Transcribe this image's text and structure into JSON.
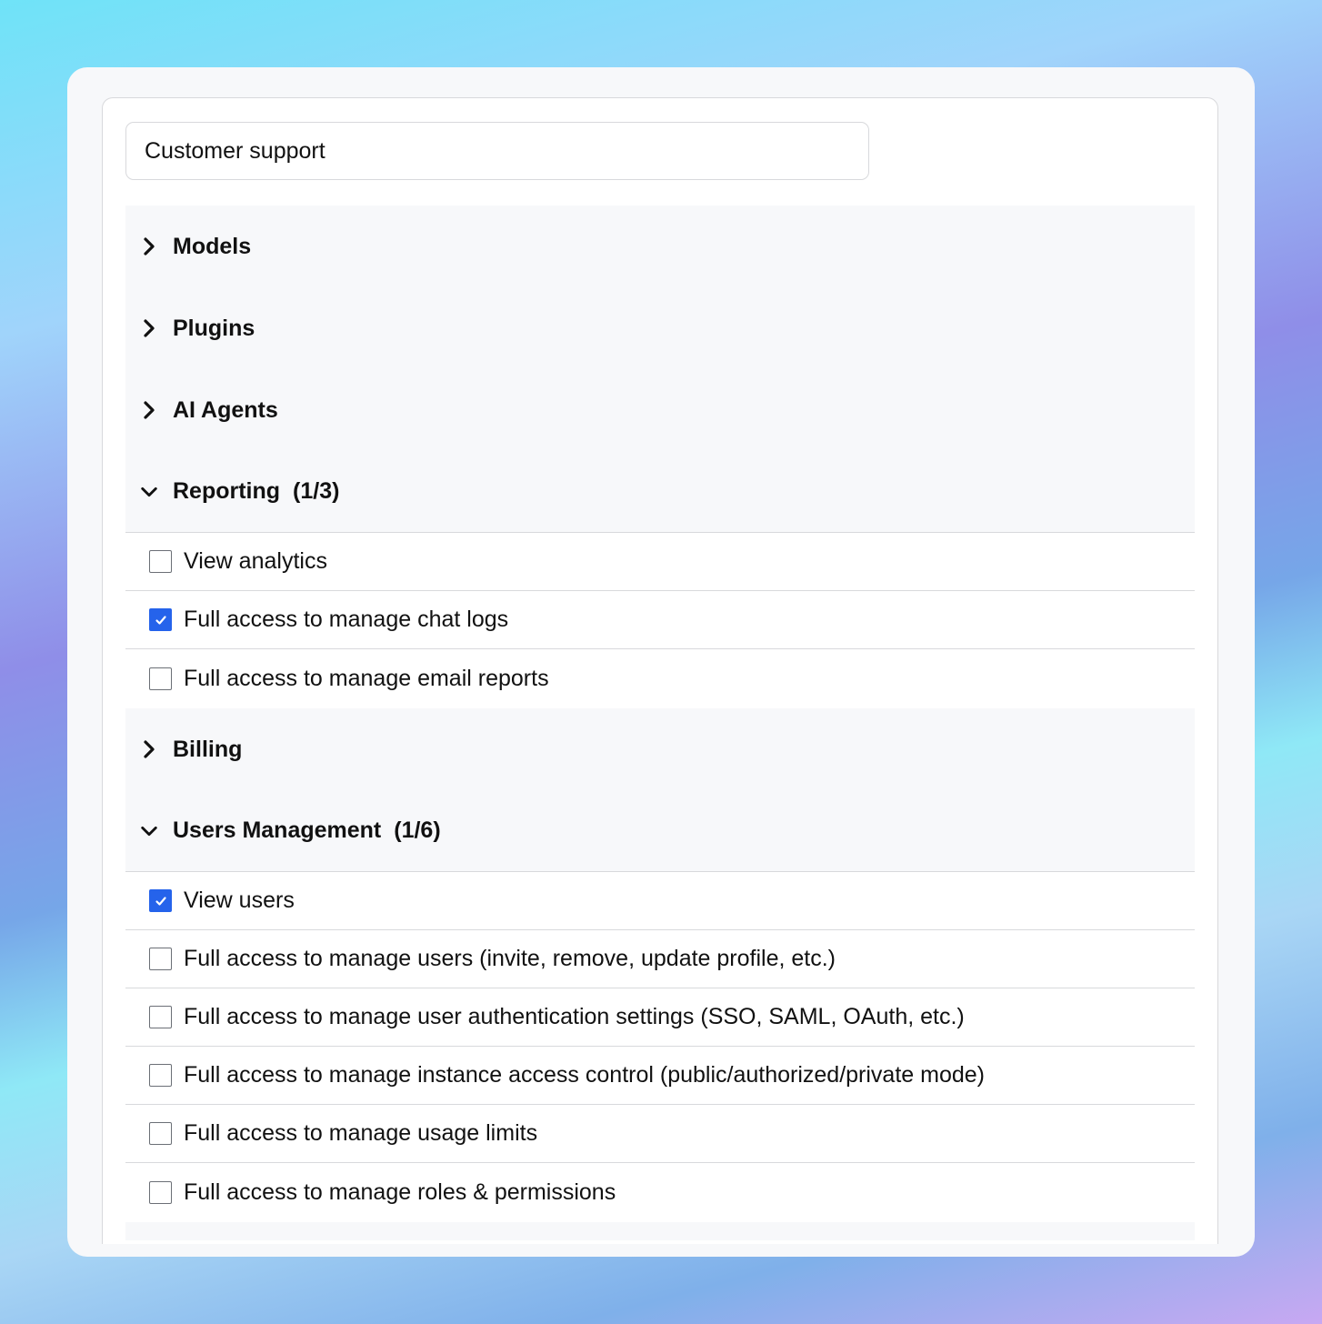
{
  "role_name": {
    "value": "Customer support",
    "placeholder": ""
  },
  "accent_color": "#2563eb",
  "groups": [
    {
      "label": "Models",
      "count": "",
      "expanded": false,
      "icon": "chevron-right-icon"
    },
    {
      "label": "Plugins",
      "count": "",
      "expanded": false,
      "icon": "chevron-right-icon"
    },
    {
      "label": "AI Agents",
      "count": "",
      "expanded": false,
      "icon": "chevron-right-icon"
    },
    {
      "label": "Reporting",
      "count": "(1/3)",
      "expanded": true,
      "icon": "chevron-down-icon",
      "permissions": [
        {
          "label": "View analytics",
          "checked": false
        },
        {
          "label": "Full access to manage chat logs",
          "checked": true
        },
        {
          "label": "Full access to manage email reports",
          "checked": false
        }
      ]
    },
    {
      "label": "Billing",
      "count": "",
      "expanded": false,
      "icon": "chevron-right-icon"
    },
    {
      "label": "Users Management",
      "count": "(1/6)",
      "expanded": true,
      "icon": "chevron-down-icon",
      "permissions": [
        {
          "label": "View users",
          "checked": true
        },
        {
          "label": "Full access to manage users (invite, remove, update profile, etc.)",
          "checked": false
        },
        {
          "label": "Full access to manage user authentication settings (SSO, SAML, OAuth, etc.)",
          "checked": false
        },
        {
          "label": "Full access to manage instance access control (public/authorized/private mode)",
          "checked": false
        },
        {
          "label": "Full access to manage usage limits",
          "checked": false
        },
        {
          "label": "Full access to manage roles & permissions",
          "checked": false
        }
      ]
    }
  ]
}
